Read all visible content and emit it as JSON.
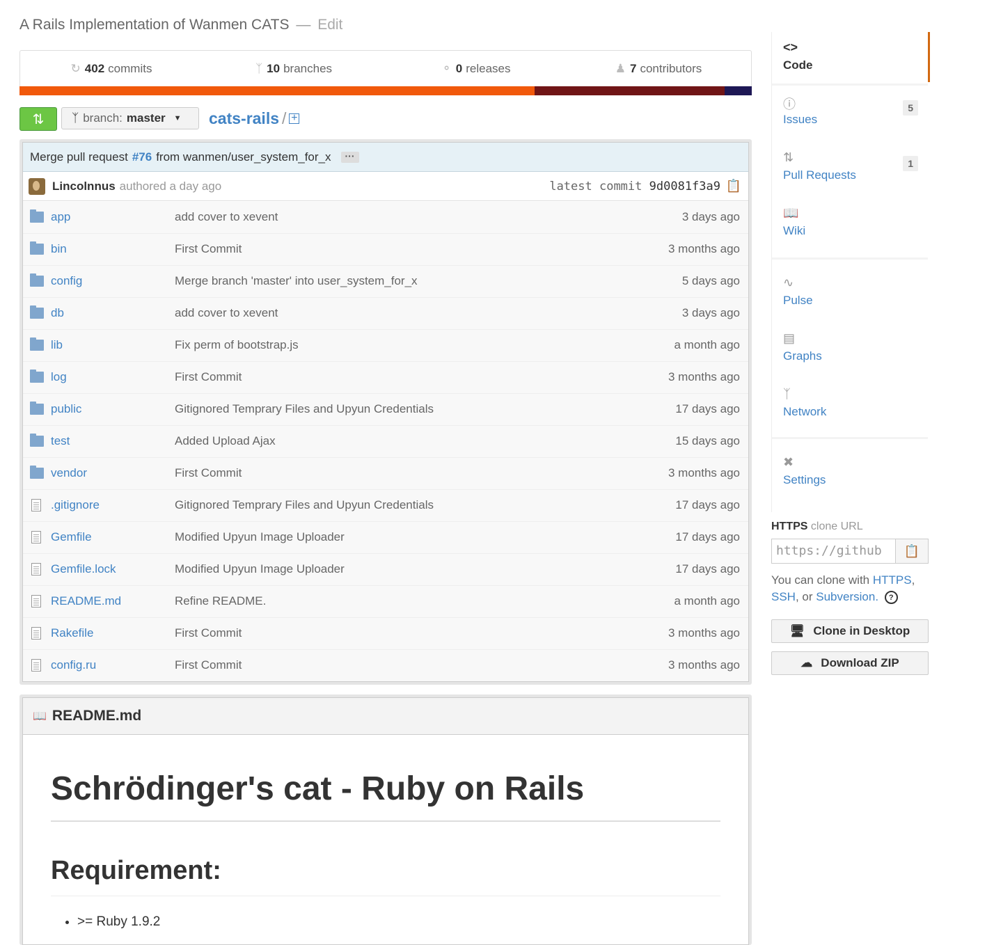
{
  "repo": {
    "description": "A Rails Implementation of Wanmen CATS",
    "separator": "—",
    "edit_label": "Edit",
    "name": "cats-rails",
    "path_slash": "/"
  },
  "stats": {
    "commits_count": "402",
    "commits_label": "commits",
    "branches_count": "10",
    "branches_label": "branches",
    "releases_count": "0",
    "releases_label": "releases",
    "contributors_count": "7",
    "contributors_label": "contributors"
  },
  "language_bar": [
    {
      "color": "#f1590b",
      "fraction": 0.703
    },
    {
      "color": "#701516",
      "fraction": 0.26
    },
    {
      "color": "#1e1855",
      "fraction": 0.037
    }
  ],
  "toolbar": {
    "branch_prefix": "branch:",
    "branch_name": "master"
  },
  "latest_commit": {
    "message_prefix": "Merge pull request",
    "pr_number": "#76",
    "message_suffix": "from wanmen/user_system_for_x",
    "ellipsis": "···",
    "author": "Lincolnnus",
    "authored": "authored a day ago",
    "latest_label": "latest commit",
    "sha": "9d0081f3a9"
  },
  "files": [
    {
      "type": "folder",
      "name": "app",
      "message": "add cover to xevent",
      "age": "3 days ago"
    },
    {
      "type": "folder",
      "name": "bin",
      "message": "First Commit",
      "age": "3 months ago"
    },
    {
      "type": "folder",
      "name": "config",
      "message": "Merge branch 'master' into user_system_for_x",
      "age": "5 days ago"
    },
    {
      "type": "folder",
      "name": "db",
      "message": "add cover to xevent",
      "age": "3 days ago"
    },
    {
      "type": "folder",
      "name": "lib",
      "message": "Fix perm of bootstrap.js",
      "age": "a month ago"
    },
    {
      "type": "folder",
      "name": "log",
      "message": "First Commit",
      "age": "3 months ago"
    },
    {
      "type": "folder",
      "name": "public",
      "message": "Gitignored Temprary Files and Upyun Credentials",
      "age": "17 days ago"
    },
    {
      "type": "folder",
      "name": "test",
      "message": "Added Upload Ajax",
      "age": "15 days ago"
    },
    {
      "type": "folder",
      "name": "vendor",
      "message": "First Commit",
      "age": "3 months ago"
    },
    {
      "type": "file",
      "name": ".gitignore",
      "message": "Gitignored Temprary Files and Upyun Credentials",
      "age": "17 days ago"
    },
    {
      "type": "file",
      "name": "Gemfile",
      "message": "Modified Upyun Image Uploader",
      "age": "17 days ago"
    },
    {
      "type": "file",
      "name": "Gemfile.lock",
      "message": "Modified Upyun Image Uploader",
      "age": "17 days ago"
    },
    {
      "type": "file",
      "name": "README.md",
      "message": "Refine README.",
      "age": "a month ago"
    },
    {
      "type": "file",
      "name": "Rakefile",
      "message": "First Commit",
      "age": "3 months ago"
    },
    {
      "type": "file",
      "name": "config.ru",
      "message": "First Commit",
      "age": "3 months ago"
    }
  ],
  "readme": {
    "filename": "README.md",
    "h1": "Schrödinger's cat - Ruby on Rails",
    "h2": "Requirement:",
    "items": [
      ">= Ruby 1.9.2"
    ]
  },
  "nav": {
    "code": "Code",
    "issues": "Issues",
    "issues_count": "5",
    "pull_requests": "Pull Requests",
    "pull_requests_count": "1",
    "wiki": "Wiki",
    "pulse": "Pulse",
    "graphs": "Graphs",
    "network": "Network",
    "settings": "Settings"
  },
  "clone": {
    "protocol": "HTTPS",
    "label": "clone URL",
    "url_value": "https://github",
    "help_prefix": "You can clone with",
    "https": "HTTPS",
    "ssh": "SSH",
    "or": ", or",
    "subversion": "Subversion",
    "period": ".",
    "help_icon": "?",
    "desktop_button": "Clone in Desktop",
    "zip_button": "Download ZIP"
  }
}
